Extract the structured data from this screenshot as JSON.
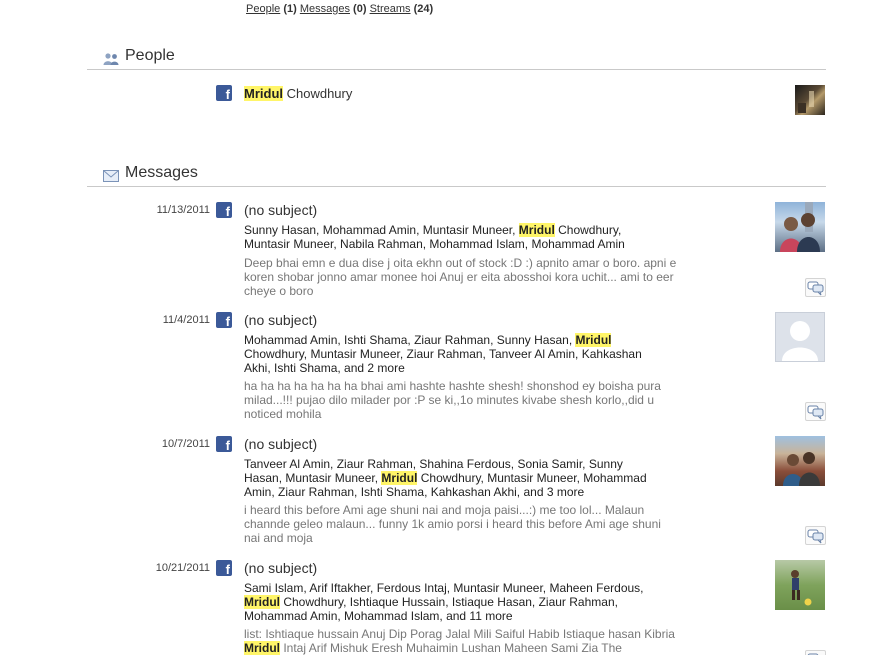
{
  "filters": {
    "people_label": "People",
    "people_count": "(1)",
    "messages_label": "Messages",
    "messages_count": "(0)",
    "streams_label": "Streams",
    "streams_count": "(24)"
  },
  "people_section": {
    "title": "People",
    "person": {
      "highlight": "Mridul",
      "rest": " Chowdhury"
    }
  },
  "messages_section": {
    "title": "Messages",
    "messages": [
      {
        "date": "11/13/2011",
        "subject": "(no subject)",
        "participants_before": "Sunny Hasan, Mohammad Amin, Muntasir Muneer, ",
        "participants_highlight": "Mridul",
        "participants_after": " Chowdhury, Muntasir Muneer, Nabila Rahman, Mohammad Islam, Mohammad Amin",
        "preview_before": "Deep bhai emn e dua dise j oita ekhn out of stock :D :) apnito amar o boro. apni e koren shobar jonno amar monee hoi Anuj er eita abosshoi kora uchit... ami to eer cheye o boro",
        "preview_highlight": "",
        "preview_after": ""
      },
      {
        "date": "11/4/2011",
        "subject": "(no subject)",
        "participants_before": "Mohammad Amin, Ishti Shama, Ziaur Rahman, Sunny Hasan, ",
        "participants_highlight": "Mridul",
        "participants_after": " Chowdhury, Muntasir Muneer, Ziaur Rahman, Tanveer Al Amin, Kahkashan Akhi, Ishti Shama, and 2 more",
        "preview_before": "ha ha ha ha ha ha ha bhai ami hashte hashte shesh! shonshod ey boisha pura milad...!!! pujao dilo milader por :P se ki,,1o minutes kivabe shesh korlo,,did u noticed mohila",
        "preview_highlight": "",
        "preview_after": ""
      },
      {
        "date": "10/7/2011",
        "subject": "(no subject)",
        "participants_before": "Tanveer Al Amin, Ziaur Rahman, Shahina Ferdous, Sonia Samir, Sunny Hasan, Muntasir Muneer, ",
        "participants_highlight": "Mridul",
        "participants_after": " Chowdhury, Muntasir Muneer, Mohammad Amin, Ziaur Rahman, Ishti Shama, Kahkashan Akhi, and 3 more",
        "preview_before": "i heard this before Ami age shuni nai and moja paisi...:) me too lol... Malaun channde geleo malaun... funny 1k amio porsi i heard this before Ami age shuni nai and moja",
        "preview_highlight": "",
        "preview_after": ""
      },
      {
        "date": "10/21/2011",
        "subject": "(no subject)",
        "participants_before": "Sami Islam, Arif Iftakher, Ferdous Intaj, Muntasir Muneer, Maheen Ferdous, ",
        "participants_highlight": "Mridul",
        "participants_after": " Chowdhury, Ishtiaque Hussain, Istiaque Hasan, Ziaur Rahman, Mohammad Amin, Mohammad Islam, and 11 more",
        "preview_before": "list: Ishtiaque hussain Anuj Dip Porag Jalal Mili Saiful Habib Istiaque hasan Kibria ",
        "preview_highlight": "Mridul",
        "preview_after": " Intaj Arif Mishuk Eresh Muhaimin Lushan Maheen Sami Zia The"
      }
    ]
  },
  "icons": {
    "facebook_letter": "f",
    "source_icon": "facebook-icon",
    "reply_icon": "comment-icon"
  },
  "colors": {
    "highlight": "#fff568",
    "facebook_blue": "#3b5998",
    "divider": "#c9c9c9"
  }
}
